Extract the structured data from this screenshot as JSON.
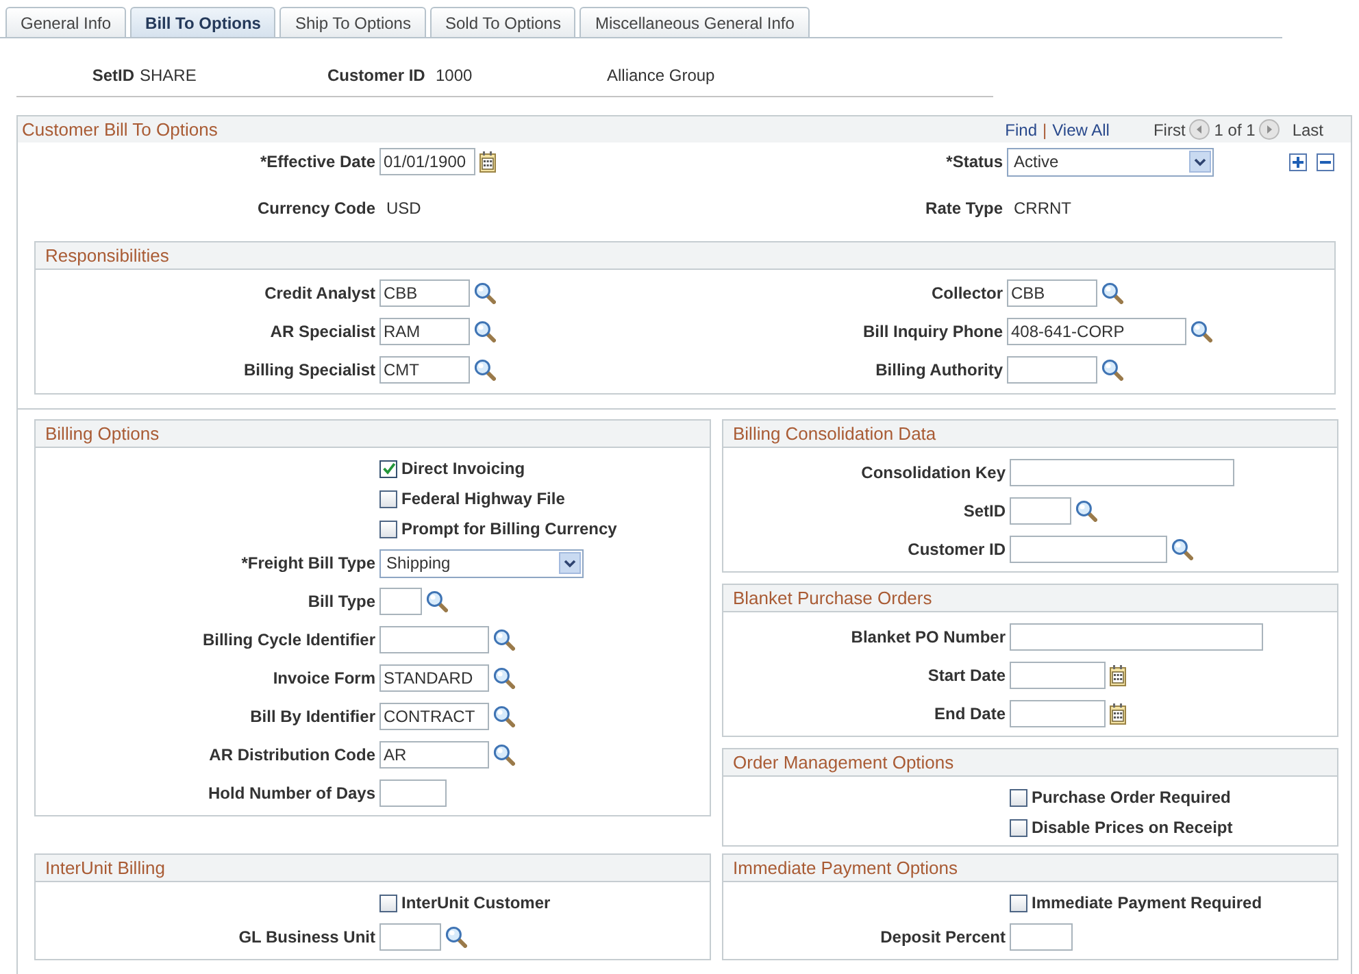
{
  "tabs": [
    {
      "label": "General Info",
      "selected": false
    },
    {
      "label": "Bill To Options",
      "selected": true
    },
    {
      "label": "Ship To Options",
      "selected": false
    },
    {
      "label": "Sold To Options",
      "selected": false
    },
    {
      "label": "Miscellaneous General Info",
      "selected": false
    }
  ],
  "header": {
    "setid": {
      "label": "SetID",
      "value": "SHARE"
    },
    "customer_id": {
      "label": "Customer ID",
      "value": "1000"
    },
    "customer_name": "Alliance Group"
  },
  "bill_to_options": {
    "title": "Customer Bill To Options",
    "nav": {
      "find": "Find",
      "separator": "|",
      "view_all": "View All",
      "first": "First",
      "previous": {
        "disabled": true
      },
      "count": "1 of 1",
      "next": {
        "disabled": true
      },
      "last": "Last"
    },
    "fields": [
      {
        "kind": "date",
        "label": "*Effective Date",
        "value": "01/01/1900"
      },
      {
        "kind": "select",
        "label": "*Status",
        "value": "Active"
      },
      {
        "kind": "text",
        "label": "Currency Code",
        "value": "USD"
      },
      {
        "kind": "text",
        "label": "Rate Type",
        "value": "CRRNT"
      }
    ]
  },
  "responsibilities": {
    "title": "Responsibilities",
    "fields": [
      {
        "kind": "lookup",
        "label": "Credit Analyst",
        "value": "CBB"
      },
      {
        "kind": "lookup",
        "label": "Collector",
        "value": "CBB"
      },
      {
        "kind": "lookup",
        "label": "AR Specialist",
        "value": "RAM"
      },
      {
        "kind": "lookup",
        "label": "Bill Inquiry Phone",
        "value": "408-641-CORP"
      },
      {
        "kind": "lookup",
        "label": "Billing Specialist",
        "value": "CMT"
      },
      {
        "kind": "lookup",
        "label": "Billing Authority"
      }
    ]
  },
  "billing_options": {
    "title": "Billing Options",
    "fields": [
      {
        "kind": "checkbox",
        "label": "Direct Invoicing",
        "checked": true
      },
      {
        "kind": "checkbox",
        "label": "Federal Highway File",
        "checked": false
      },
      {
        "kind": "checkbox",
        "label": "Prompt for Billing Currency",
        "checked": false
      },
      {
        "kind": "select",
        "label": "*Freight Bill Type",
        "value": "Shipping"
      },
      {
        "kind": "lookup",
        "label": "Bill Type"
      },
      {
        "kind": "lookup",
        "label": "Billing Cycle Identifier"
      },
      {
        "kind": "lookup",
        "label": "Invoice Form",
        "value": "STANDARD"
      },
      {
        "kind": "lookup",
        "label": "Bill By Identifier",
        "value": "CONTRACT"
      },
      {
        "kind": "lookup",
        "label": "AR Distribution Code",
        "value": "AR"
      },
      {
        "kind": "input",
        "label": "Hold Number of Days"
      }
    ]
  },
  "billing_consolidation_data": {
    "title": "Billing Consolidation Data",
    "fields": [
      {
        "kind": "input",
        "label": "Consolidation Key"
      },
      {
        "kind": "lookup",
        "label": "SetID"
      },
      {
        "kind": "lookup",
        "label": "Customer ID"
      }
    ]
  },
  "blanket_purchase_orders": {
    "title": "Blanket Purchase Orders",
    "fields": [
      {
        "kind": "input",
        "label": "Blanket PO Number"
      },
      {
        "kind": "date",
        "label": "Start Date"
      },
      {
        "kind": "date",
        "label": "End Date"
      }
    ]
  },
  "order_management_options": {
    "title": "Order Management Options",
    "fields": [
      {
        "kind": "checkbox",
        "label": "Purchase Order Required",
        "checked": false
      },
      {
        "kind": "checkbox",
        "label": "Disable Prices on Receipt",
        "checked": false
      }
    ]
  },
  "interunit_billing": {
    "title": "InterUnit Billing",
    "fields": [
      {
        "kind": "checkbox",
        "label": "InterUnit Customer",
        "checked": false
      },
      {
        "kind": "lookup",
        "label": "GL Business Unit"
      }
    ]
  },
  "immediate_payment_options": {
    "title": "Immediate Payment Options",
    "fields": [
      {
        "kind": "checkbox",
        "label": "Immediate Payment Required",
        "checked": false
      },
      {
        "kind": "input",
        "label": "Deposit Percent"
      }
    ]
  }
}
